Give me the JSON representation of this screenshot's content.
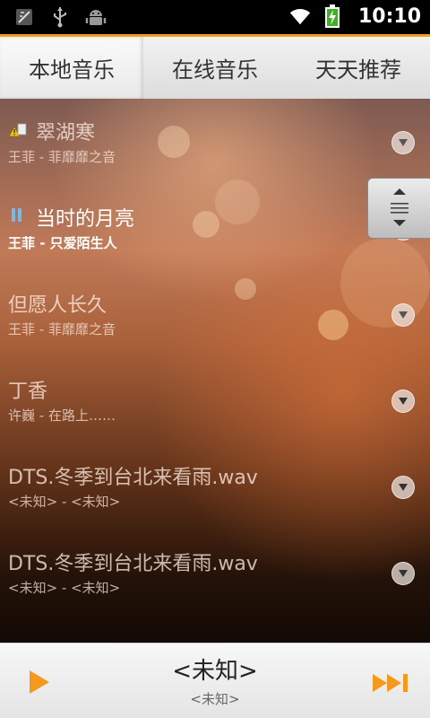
{
  "status_bar": {
    "time": "10:10",
    "icons": [
      "no-sim-icon",
      "usb-icon",
      "android-debug-icon",
      "wifi-icon",
      "battery-charging-icon"
    ]
  },
  "tabs": [
    {
      "label": "本地音乐",
      "active": true
    },
    {
      "label": "在线音乐",
      "active": false
    },
    {
      "label": "天天推荐",
      "active": false
    }
  ],
  "songs": [
    {
      "title": "翠湖寒",
      "subtitle": "王菲 - 菲靡靡之音",
      "icon": "warning-file-icon",
      "playing": false
    },
    {
      "title": "当时的月亮",
      "subtitle": "王菲 - 只爱陌生人",
      "icon": "pause-icon",
      "playing": true
    },
    {
      "title": "但愿人长久",
      "subtitle": "王菲 - 菲靡靡之音",
      "icon": "",
      "playing": false
    },
    {
      "title": "丁香",
      "subtitle": "许巍 - 在路上……",
      "icon": "",
      "playing": false
    },
    {
      "title": "DTS.冬季到台北来看雨.wav",
      "subtitle": "<未知> - <未知>",
      "icon": "",
      "playing": false
    },
    {
      "title": "DTS.冬季到台北来看雨.wav",
      "subtitle": "<未知> - <未知>",
      "icon": "",
      "playing": false
    }
  ],
  "now_playing": {
    "title": "<未知>",
    "artist": "<未知>"
  },
  "colors": {
    "accent": "#f39a1e",
    "play_button": "#f39a1e"
  }
}
